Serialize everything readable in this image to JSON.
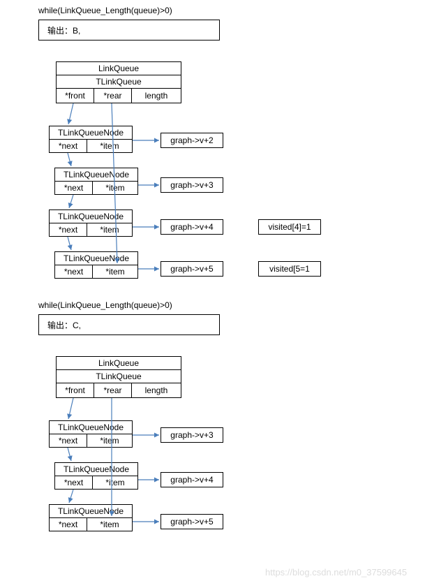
{
  "section1": {
    "while": "while(LinkQueue_Length(queue)>0)",
    "output": "输出：B,",
    "linkqueue": {
      "title": "LinkQueue",
      "subtitle": "TLinkQueue",
      "front": "*front",
      "rear": "*rear",
      "length": "length"
    },
    "nodes": [
      {
        "title": "TLinkQueueNode",
        "next": "*next",
        "item": "*item",
        "target": "graph->v+2",
        "visited": ""
      },
      {
        "title": "TLinkQueueNode",
        "next": "*next",
        "item": "*item",
        "target": "graph->v+3",
        "visited": ""
      },
      {
        "title": "TLinkQueueNode",
        "next": "*next",
        "item": "*item",
        "target": "graph->v+4",
        "visited": "visited[4]=1"
      },
      {
        "title": "TLinkQueueNode",
        "next": "*next",
        "item": "*item",
        "target": "graph->v+5",
        "visited": "visited[5=1"
      }
    ]
  },
  "section2": {
    "while": "while(LinkQueue_Length(queue)>0)",
    "output": "输出：C,",
    "linkqueue": {
      "title": "LinkQueue",
      "subtitle": "TLinkQueue",
      "front": "*front",
      "rear": "*rear",
      "length": "length"
    },
    "nodes": [
      {
        "title": "TLinkQueueNode",
        "next": "*next",
        "item": "*item",
        "target": "graph->v+3"
      },
      {
        "title": "TLinkQueueNode",
        "next": "*next",
        "item": "*item",
        "target": "graph->v+4"
      },
      {
        "title": "TLinkQueueNode",
        "next": "*next",
        "item": "*item",
        "target": "graph->v+5"
      }
    ]
  },
  "watermark": "https://blog.csdn.net/m0_37599645"
}
